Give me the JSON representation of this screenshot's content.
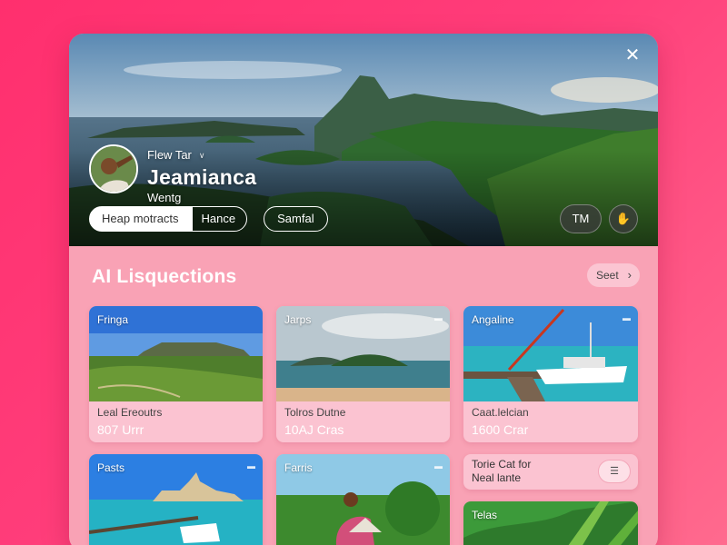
{
  "hero": {
    "close_icon": "close-icon",
    "profile": {
      "small_label": "Flew Tar",
      "chevron": "∨",
      "name": "Jeamianca",
      "subtitle": "Wentg"
    },
    "chips": [
      "Heap motracts",
      "Hance",
      "Samfal"
    ],
    "buttons": {
      "tm_label": "TM",
      "icon_name": "hand-icon"
    }
  },
  "section": {
    "title": "AI Lisquections",
    "see_label": "Seet",
    "see_arrow": "›"
  },
  "tiles": [
    {
      "tag": "Fringa",
      "line1": "Leal Ereoutrs",
      "line2": "807 Urrr"
    },
    {
      "tag": "Jarps",
      "line1": "Tolros Dutne",
      "line2": "10AJ Cras"
    },
    {
      "tag": "Angaline",
      "line1": "Caat.lelcian",
      "line2": "1600 Crar"
    },
    {
      "tag": "Pasts",
      "line1": "",
      "line2": ""
    },
    {
      "tag": "Farris",
      "line1": "",
      "line2": ""
    },
    {
      "tag": "Telas",
      "line1": "",
      "line2": ""
    }
  ],
  "mini_card": {
    "line1": "Torie Cat for",
    "line2": "Neal lante",
    "icon_name": "list-icon"
  },
  "colors": {
    "background": "#ff2f6e",
    "card": "#f9a2b5",
    "tile": "#fbc3d1"
  }
}
